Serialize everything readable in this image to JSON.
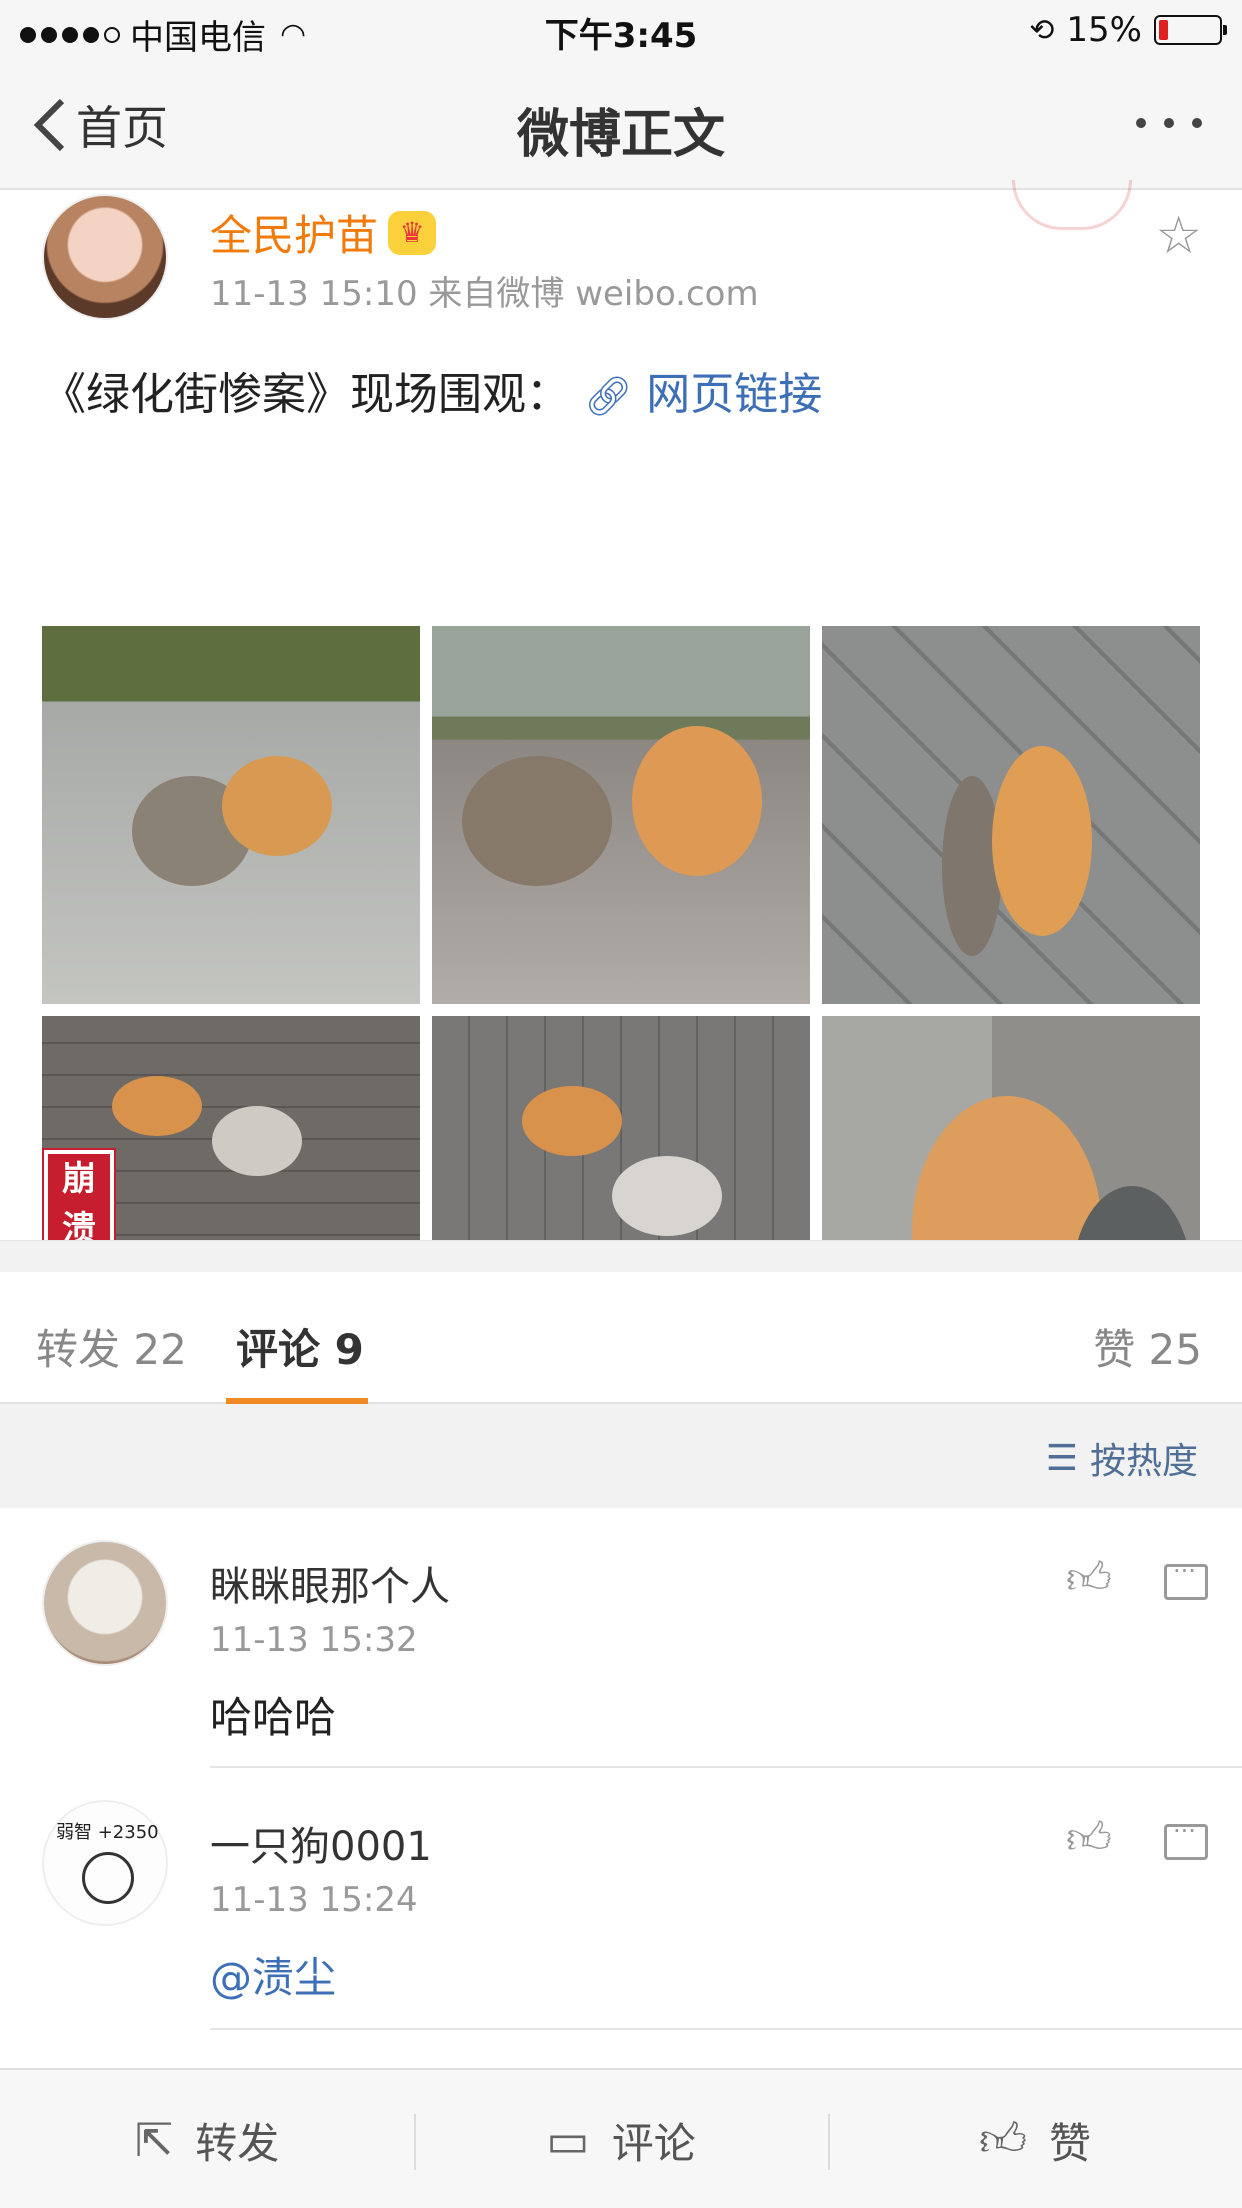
{
  "status_bar": {
    "carrier": "中国电信",
    "time": "下午3:45",
    "battery_percent": "15%",
    "battery_level": 0.15
  },
  "nav": {
    "back_label": "首页",
    "title": "微博正文"
  },
  "post": {
    "username": "全民护苗",
    "meta": "11-13 15:10  来自微博 weibo.com",
    "text": "《绿化街惨案》现场围观：",
    "link_label": "网页链接",
    "photo_stamp": "崩溃",
    "photo_count": 6
  },
  "tabs": {
    "repost": "转发 22",
    "comments": "评论 9",
    "likes": "赞 25"
  },
  "sort": {
    "label": "按热度"
  },
  "comments": [
    {
      "name": "眯眯眼那个人",
      "time": "11-13 15:32",
      "text": "哈哈哈"
    },
    {
      "name": "一只狗0001",
      "time": "11-13 15:24",
      "text": "@渍尘",
      "avatar_caption": "弱智 +2350"
    }
  ],
  "toolbar": {
    "repost": "转发",
    "comment": "评论",
    "like": "赞"
  },
  "colors": {
    "username_orange": "#f07a0a",
    "link_blue": "#3d6fb6",
    "tab_underline": "#f08a24",
    "battery_red": "#e02020"
  }
}
